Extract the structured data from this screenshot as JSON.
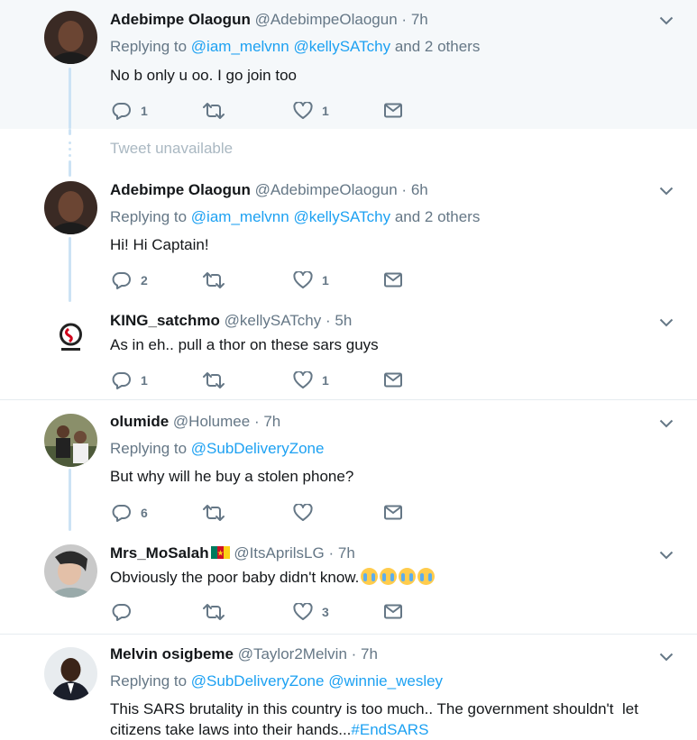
{
  "tweets": [
    {
      "name": "Adebimpe Olaogun",
      "handle": "@AdebimpeOlaogun",
      "time": "7h",
      "replying_prefix": "Replying to",
      "mentions": [
        "@iam_melvnn",
        "@kellySATchy"
      ],
      "others": "and 2 others",
      "text": "No b only u oo. I go join too",
      "replies": "1",
      "retweets": "",
      "likes": "1"
    },
    {
      "name": "Adebimpe Olaogun",
      "handle": "@AdebimpeOlaogun",
      "time": "6h",
      "replying_prefix": "Replying to",
      "mentions": [
        "@iam_melvnn",
        "@kellySATchy"
      ],
      "others": "and 2 others",
      "text": "Hi! Hi Captain!",
      "replies": "2",
      "retweets": "",
      "likes": "1"
    },
    {
      "name": "KING_satchmo",
      "handle": "@kellySATchy",
      "time": "5h",
      "text": "As in eh.. pull a thor on these sars guys",
      "replies": "1",
      "retweets": "",
      "likes": "1"
    },
    {
      "name": "olumide",
      "handle": "@Holumee",
      "time": "7h",
      "replying_prefix": "Replying to",
      "mentions": [
        "@SubDeliveryZone"
      ],
      "text": "But why will he buy a stolen phone?",
      "replies": "6",
      "retweets": "",
      "likes": ""
    },
    {
      "name": "Mrs_MoSalah",
      "handle": "@ItsAprilsLG",
      "time": "7h",
      "text": "Obviously the poor baby didn't know.",
      "replies": "",
      "retweets": "",
      "likes": "3"
    },
    {
      "name": "Melvin osigbeme",
      "handle": "@Taylor2Melvin",
      "time": "7h",
      "replying_prefix": "Replying to",
      "mentions": [
        "@SubDeliveryZone",
        "@winnie_wesley"
      ],
      "text_line1": "This SARS brutality in this country is too much.. The government shouldn't  let",
      "text_line2": "citizens take laws into their hands...",
      "hashtag": "#EndSARS"
    }
  ],
  "unavailable_text": "Tweet unavailable",
  "separator": "·",
  "icons": {
    "reply": "reply-icon",
    "retweet": "retweet-icon",
    "like": "heart-icon",
    "dm": "envelope-icon",
    "caret": "chevron-down-icon",
    "emoji": "loudly-crying-face-emoji",
    "flag": "cameroon-flag"
  },
  "colors": {
    "link": "#1da1f2",
    "muted": "#657786",
    "thread_line": "#cce3f5",
    "highlight_bg": "#f5f8fa"
  }
}
